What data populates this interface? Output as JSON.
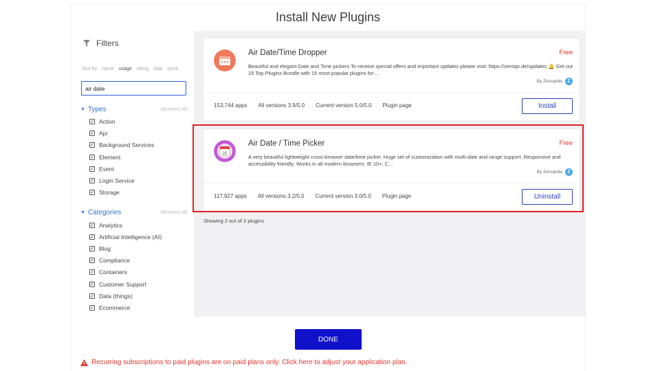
{
  "modal": {
    "title": "Install New Plugins"
  },
  "sidebar": {
    "filters_label": "Filters",
    "sort": {
      "label": "Sort by",
      "options": [
        "name",
        "usage",
        "rating",
        "date",
        "price"
      ],
      "active": "usage"
    },
    "search_value": "air date",
    "types": {
      "label": "Types",
      "deselect": "(deselect all)",
      "items": [
        "Action",
        "Api",
        "Background Services",
        "Element",
        "Event",
        "Login Service",
        "Storage"
      ]
    },
    "categories": {
      "label": "Categories",
      "deselect": "(deselect all)",
      "items": [
        "Analytics",
        "Artificial Intelligence (AI)",
        "Blog",
        "Compliance",
        "Containers",
        "Customer Support",
        "Data (things)",
        "Ecommerce"
      ]
    }
  },
  "plugins": [
    {
      "name": "Air Date/Time Dropper",
      "price": "Free",
      "description": "Beautiful and elegant Date and Time pickers To receive special offers and important updates please visit: https://zeroqo.de/updates 🔔 Get our 15 Top Plugins Bundle with 15 most popular plugins for ...",
      "author": "By Zeroqode",
      "apps": "153,744 apps",
      "all_versions": "All versions 3.9/5.0",
      "current_version": "Current version 5.0/5.0",
      "plugin_page": "Plugin page",
      "action": "Install",
      "logo_color": "#f07a5b"
    },
    {
      "name": "Air Date / Time Picker",
      "price": "Free",
      "description": "A very beautiful lightweight cross-browser date/time picker. Huge set of customization with multi-date and range support. Responsive and accessibility friendly. Works in all modern browsers: IE 10+, C...",
      "author": "By Zeroqode",
      "apps": "117,927 apps",
      "all_versions": "All versions 3.2/5.0",
      "current_version": "Current version 3.0/5.0",
      "plugin_page": "Plugin page",
      "action": "Uninstall",
      "logo_color": "#c45ad6"
    }
  ],
  "showing": "Showing 2 out of 2 plugins",
  "footer": {
    "done_label": "DONE",
    "warning": "Recurring subscriptions to paid plugins are on paid plans only. Click here to adjust your application plan."
  },
  "colors": {
    "accent": "#2a3fb6",
    "done_bg": "#1111cc",
    "danger": "#e2342b",
    "link_blue": "#2f6fd6"
  }
}
